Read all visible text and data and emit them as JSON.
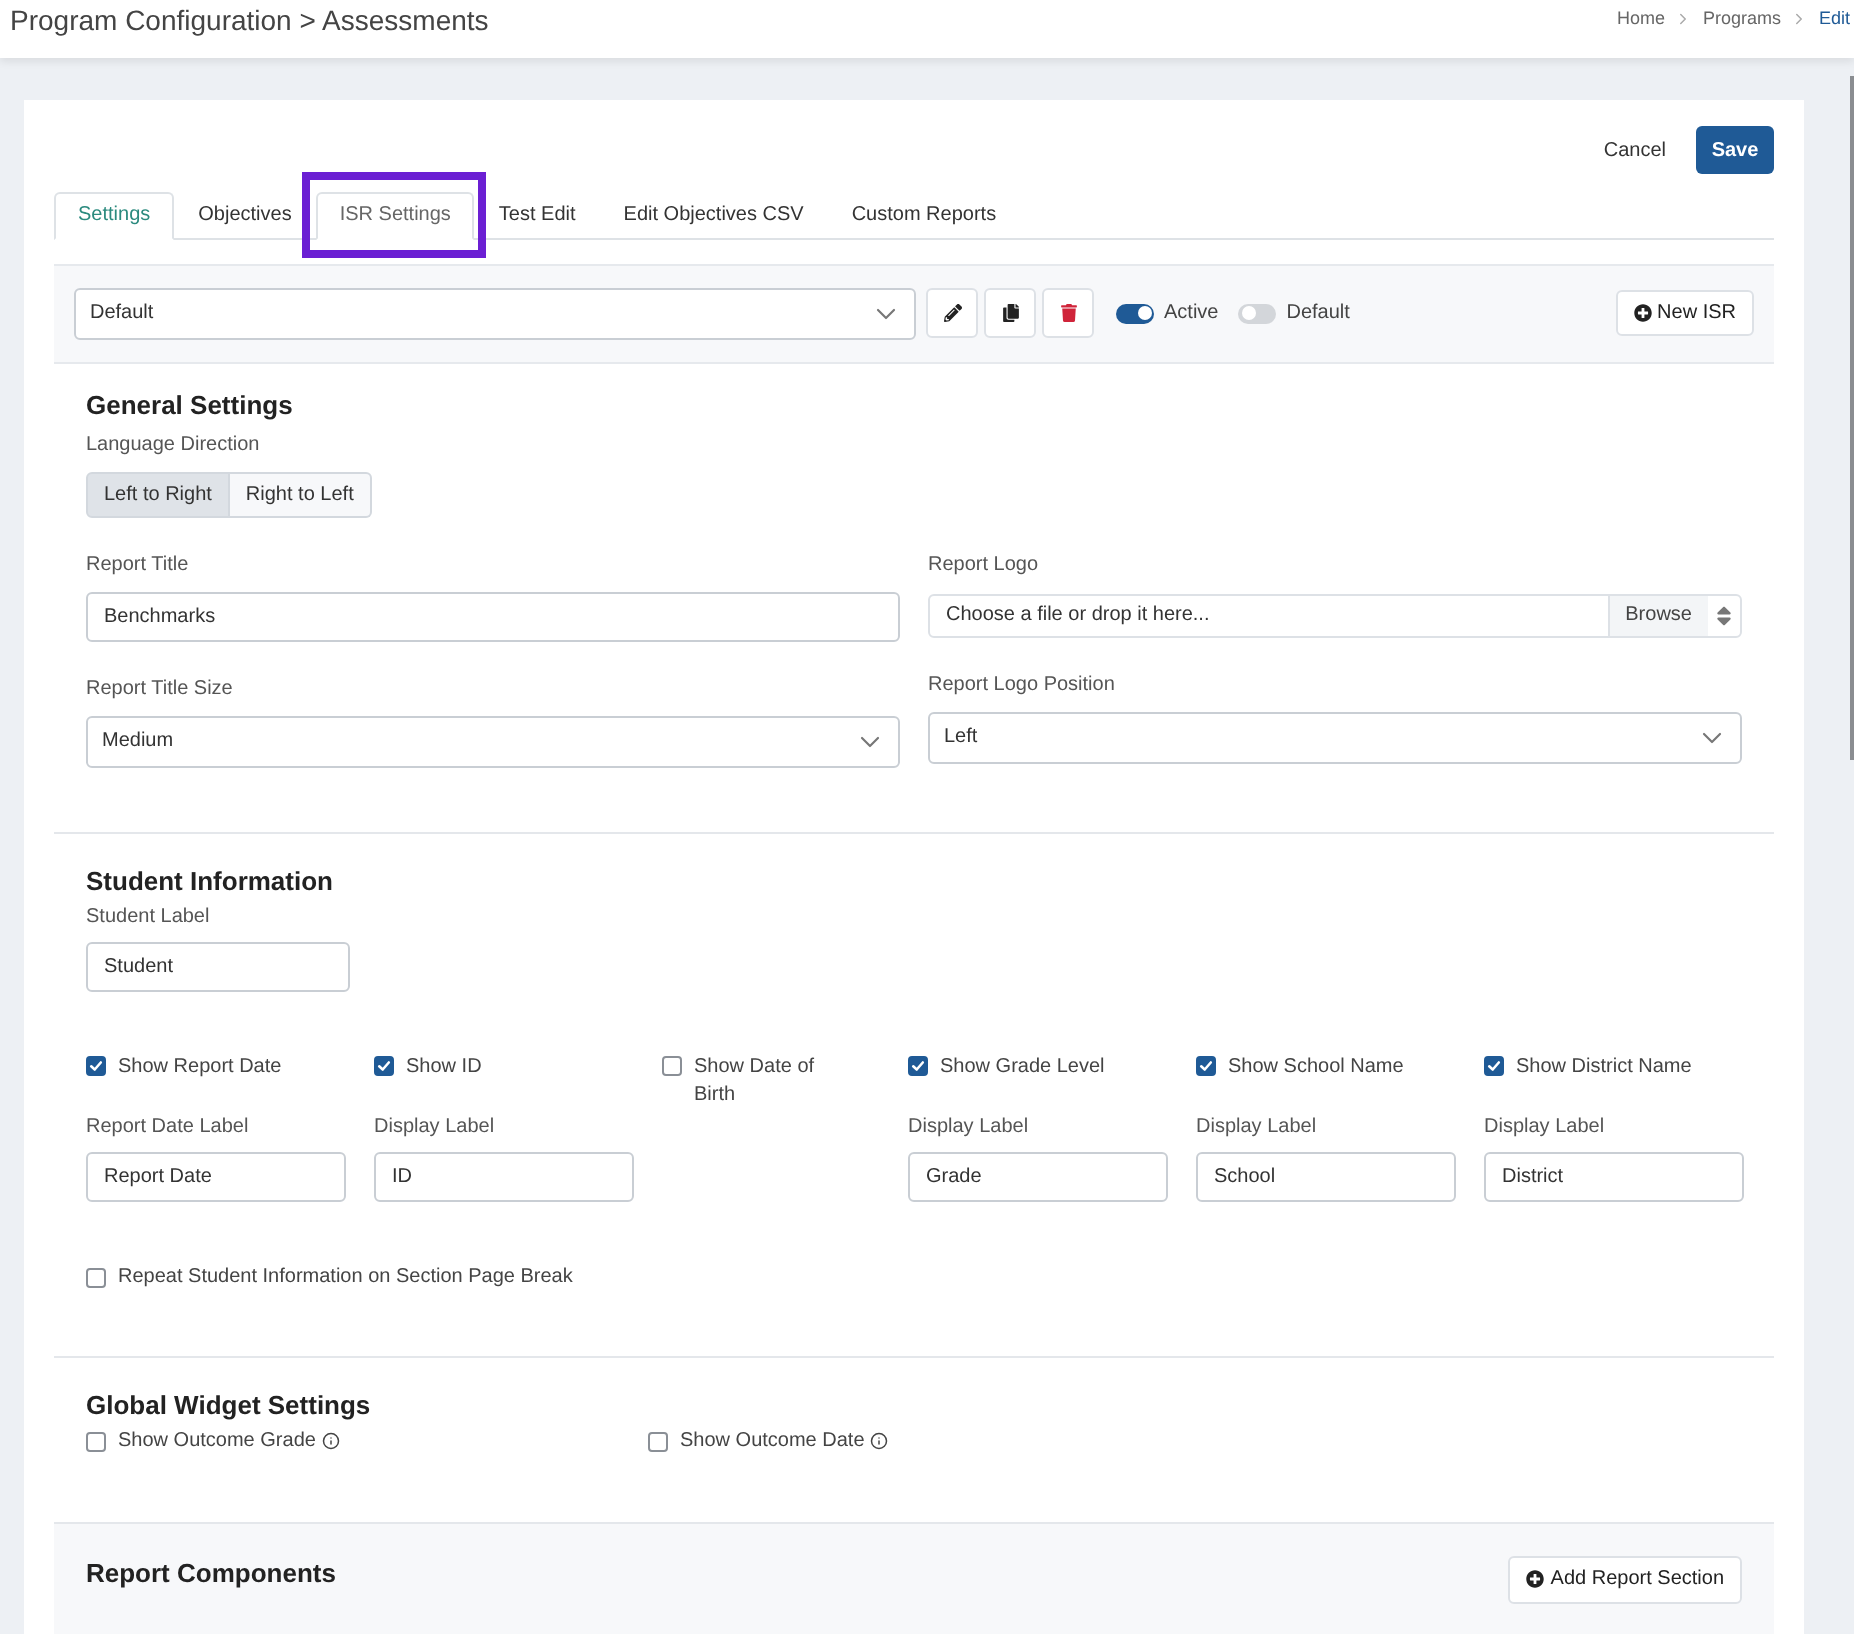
{
  "header": {
    "title": "Program Configuration > Assessments",
    "breadcrumb": [
      {
        "label": "Home",
        "current": false
      },
      {
        "label": "Programs",
        "current": false
      },
      {
        "label": "Edit",
        "current": true
      }
    ]
  },
  "actions": {
    "cancel": "Cancel",
    "save": "Save"
  },
  "tabs": [
    {
      "label": "Settings",
      "selected": false,
      "hovered": true,
      "outlined": false
    },
    {
      "label": "Objectives",
      "selected": false,
      "hovered": false,
      "outlined": false
    },
    {
      "label": "ISR Settings",
      "selected": true,
      "hovered": false,
      "outlined": true
    },
    {
      "label": "Test Edit",
      "selected": false,
      "hovered": false,
      "outlined": false
    },
    {
      "label": "Edit Objectives CSV",
      "selected": false,
      "hovered": false,
      "outlined": false
    },
    {
      "label": "Custom Reports",
      "selected": false,
      "hovered": false,
      "outlined": false
    }
  ],
  "toolbar": {
    "isr_select": {
      "value": "Default"
    },
    "tools": [
      {
        "kind": "edit"
      },
      {
        "kind": "copy"
      },
      {
        "kind": "delete"
      }
    ],
    "toggles": [
      {
        "label": "Active",
        "on": true
      },
      {
        "label": "Default",
        "on": false
      }
    ],
    "new_button": "New ISR"
  },
  "general_settings": {
    "heading": "General Settings",
    "language_direction": {
      "label": "Language Direction",
      "options": [
        {
          "label": "Left to Right",
          "selected": true
        },
        {
          "label": "Right to Left",
          "selected": false
        }
      ]
    },
    "report_title": {
      "label": "Report Title",
      "value": "Benchmarks"
    },
    "report_logo": {
      "label": "Report Logo",
      "placeholder": "Choose a file or drop it here...",
      "button": "Browse"
    },
    "report_title_size": {
      "label": "Report Title Size",
      "value": "Medium"
    },
    "report_logo_position": {
      "label": "Report Logo Position",
      "value": "Left"
    }
  },
  "student_information": {
    "heading": "Student Information",
    "student_label": {
      "label": "Student Label",
      "value": "Student"
    },
    "fields": [
      {
        "label": "Show Report Date",
        "checked": true,
        "display_label": "Report Date Label",
        "value": "Report Date"
      },
      {
        "label": "Show ID",
        "checked": true,
        "display_label": "Display Label",
        "value": "ID"
      },
      {
        "label": "Show Date of Birth",
        "checked": false
      },
      {
        "label": "Show Grade Level",
        "checked": true,
        "display_label": "Display Label",
        "value": "Grade"
      },
      {
        "label": "Show School Name",
        "checked": true,
        "display_label": "Display Label",
        "value": "School"
      },
      {
        "label": "Show District Name",
        "checked": true,
        "display_label": "Display Label",
        "value": "District"
      }
    ],
    "repeat": {
      "label": "Repeat Student Information on Section Page Break",
      "checked": false
    }
  },
  "global_widget_settings": {
    "heading": "Global Widget Settings",
    "options": [
      {
        "label": "Show Outcome Grade",
        "checked": false
      },
      {
        "label": "Show Outcome Date",
        "checked": false
      }
    ]
  },
  "report_components": {
    "heading": "Report Components",
    "button": "Add Report Section"
  }
}
